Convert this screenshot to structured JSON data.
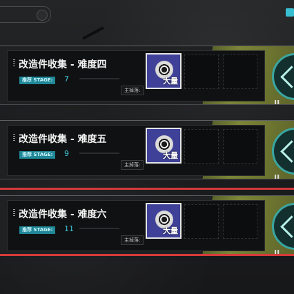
{
  "stages": [
    {
      "title": "改造件收集 - 难度四",
      "recommended_value": "7",
      "drop_amount": "大量"
    },
    {
      "title": "改造件收集 - 难度五",
      "recommended_value": "9",
      "drop_amount": "大量"
    },
    {
      "title": "改造件收集 - 难度六",
      "recommended_value": "11",
      "drop_amount": "大量"
    }
  ],
  "common": {
    "recommended_label": "推荐 STAGE:",
    "main_drop_label": "主掉落:",
    "start_hint": "II"
  },
  "colors": {
    "accent_cyan": "#3fc5d8",
    "badge_teal": "#1f8797",
    "red_line": "#d63a3a",
    "item_blue": "#3f4199",
    "stripe_olive": "#9aa63e"
  },
  "icons": {
    "drop_item": "disc-part-icon",
    "start": "chevron-start-icon",
    "top_corner": "menu-icon"
  }
}
